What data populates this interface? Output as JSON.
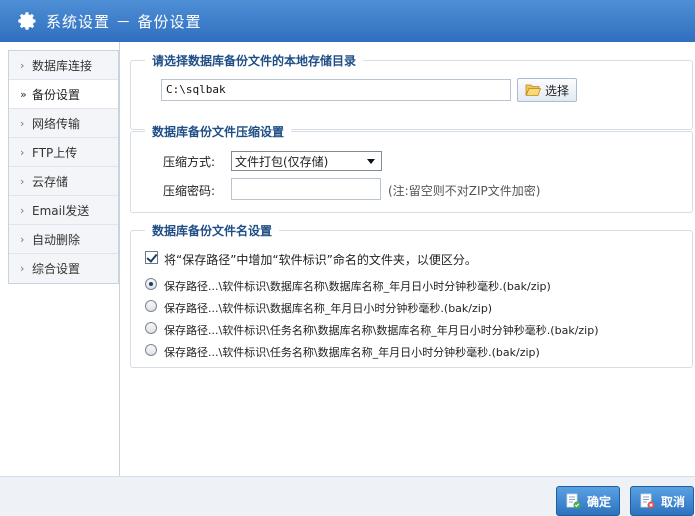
{
  "window": {
    "title": "系统设置 － 备份设置"
  },
  "sidebar": {
    "items": [
      {
        "label": "数据库连接",
        "active": false
      },
      {
        "label": "备份设置",
        "active": true
      },
      {
        "label": "网络传输",
        "active": false
      },
      {
        "label": "FTP上传",
        "active": false
      },
      {
        "label": "云存储",
        "active": false
      },
      {
        "label": "Email发送",
        "active": false
      },
      {
        "label": "自动删除",
        "active": false
      },
      {
        "label": "综合设置",
        "active": false
      }
    ]
  },
  "storage": {
    "title": "请选择数据库备份文件的本地存储目录",
    "path_value": "C:\\sqlbak",
    "select_label": "选择"
  },
  "compression": {
    "title": "数据库备份文件压缩设置",
    "method_label": "压缩方式:",
    "method_value": "文件打包(仅存储)",
    "password_label": "压缩密码:",
    "password_value": "",
    "password_hint": "(注:留空则不对ZIP文件加密)"
  },
  "naming": {
    "title": "数据库备份文件名设置",
    "checkbox_label": "将“保存路径”中增加“软件标识”命名的文件夹，以便区分。",
    "checkbox_checked": true,
    "options": [
      {
        "label": "保存路径...\\软件标识\\数据库名称\\数据库名称_年月日小时分钟秒毫秒.(bak/zip)",
        "checked": true
      },
      {
        "label": "保存路径...\\软件标识\\数据库名称_年月日小时分钟秒毫秒.(bak/zip)",
        "checked": false
      },
      {
        "label": "保存路径...\\软件标识\\任务名称\\数据库名称\\数据库名称_年月日小时分钟秒毫秒.(bak/zip)",
        "checked": false
      },
      {
        "label": "保存路径...\\软件标识\\任务名称\\数据库名称_年月日小时分钟秒毫秒.(bak/zip)",
        "checked": false
      }
    ]
  },
  "actions": {
    "ok_label": "确定",
    "cancel_label": "取消"
  },
  "colors": {
    "titlebar": "#3a7bcc",
    "group_title": "#1f4f86",
    "button": "#2c72bf"
  }
}
